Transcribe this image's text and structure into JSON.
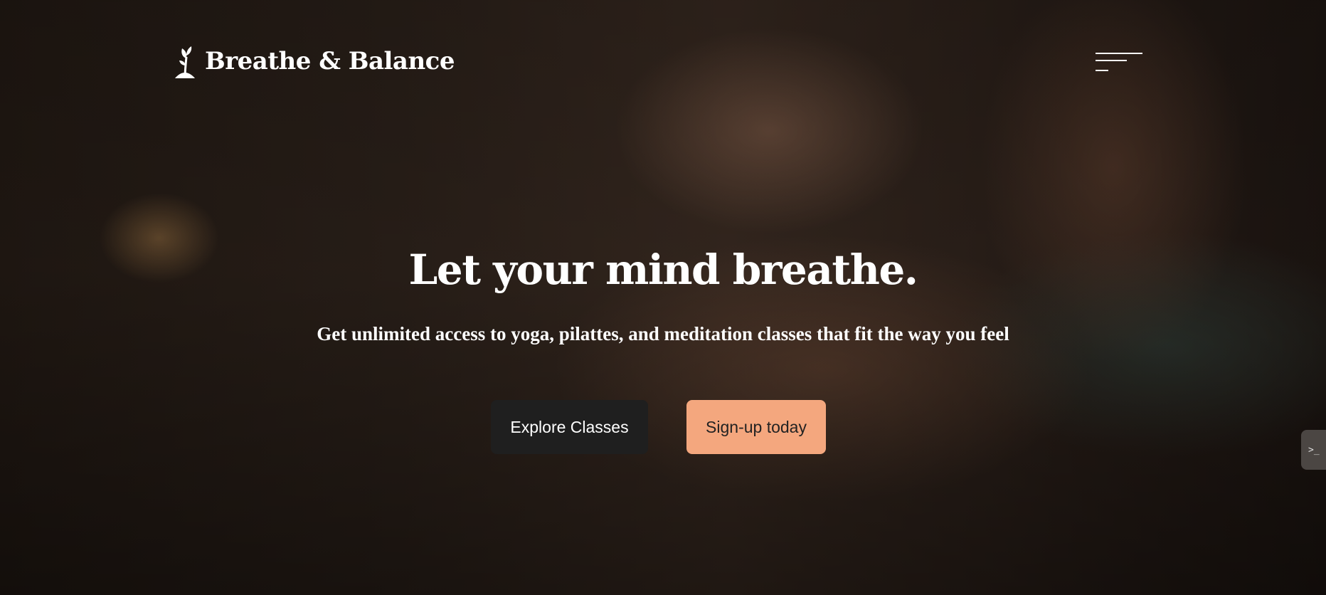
{
  "brand": {
    "name": "Breathe & Balance",
    "logo_icon": "sprout-figure-icon"
  },
  "nav": {
    "menu_icon": "hamburger-menu-icon"
  },
  "hero": {
    "headline": "Let your mind breathe.",
    "subheadline": "Get unlimited access to yoga, pilattes, and meditation classes that fit the way you feel",
    "background": "meditation-photo"
  },
  "buttons": {
    "explore": "Explore Classes",
    "signup": "Sign-up today"
  },
  "side_tab": {
    "icon": "terminal-icon",
    "label": ">_"
  },
  "colors": {
    "primary_button": "#1f1f1f",
    "accent_button": "#f4a77e",
    "text": "#ffffff"
  }
}
